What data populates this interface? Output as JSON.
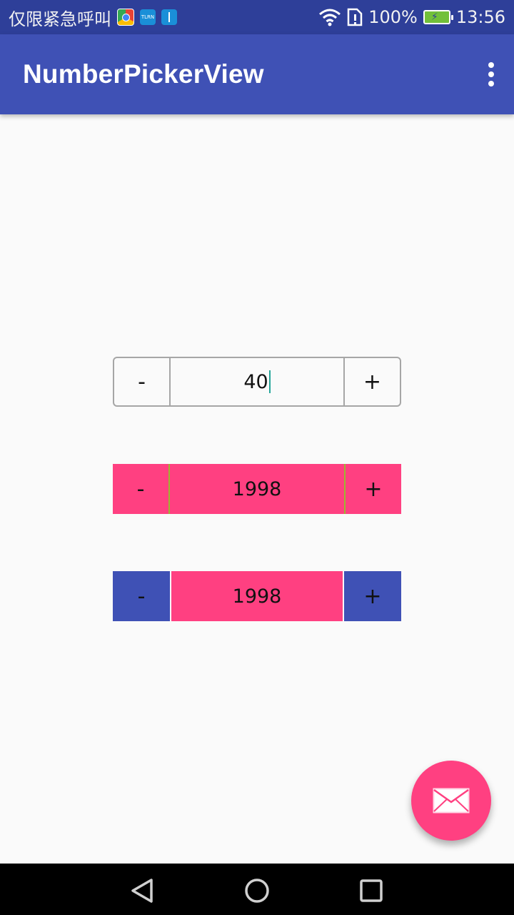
{
  "status_bar": {
    "carrier": "仅限紧急呼叫",
    "notification_icons": [
      "browser-icon",
      "app-icon",
      "usb-icon"
    ],
    "app_icon_text": "TLRN",
    "battery_percent": "100%",
    "battery_level": 1.0,
    "time": "13:56"
  },
  "app_bar": {
    "title": "NumberPickerView",
    "background_color": "#3f51b5",
    "overflow_icon": "more-vert-icon"
  },
  "pickers": [
    {
      "minus_label": "-",
      "value": "40",
      "plus_label": "+",
      "style": "outlined"
    },
    {
      "minus_label": "-",
      "value": "1998",
      "plus_label": "+",
      "style": "pink",
      "color": "#ff4081"
    },
    {
      "minus_label": "-",
      "value": "1998",
      "plus_label": "+",
      "style": "indigo-pink",
      "button_color": "#3f51b5",
      "value_color": "#ff4081"
    }
  ],
  "fab": {
    "icon": "email-icon",
    "color": "#ff4081"
  },
  "nav_bar": {
    "icons": [
      "back-icon",
      "home-icon",
      "recents-icon"
    ]
  }
}
